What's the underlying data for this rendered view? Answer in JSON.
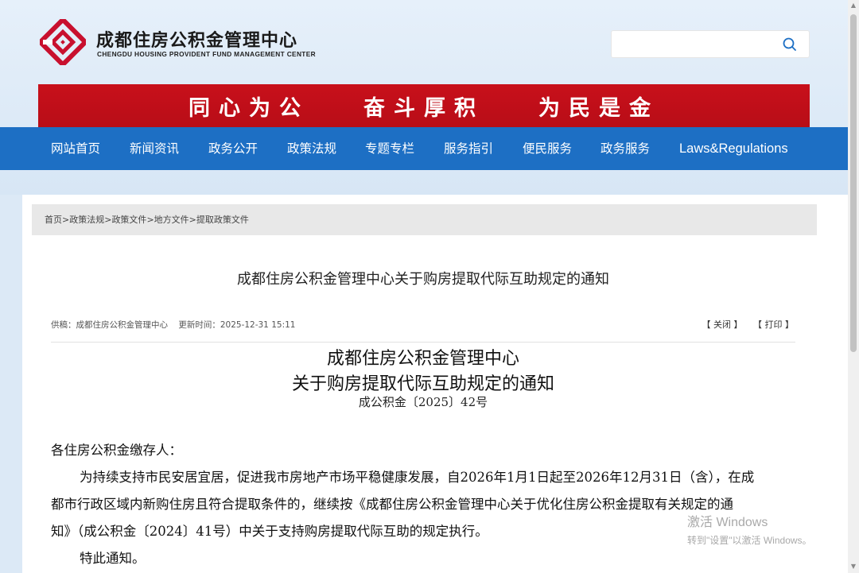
{
  "header": {
    "org_name_cn": "成都住房公积金管理中心",
    "org_name_en": "CHENGDU HOUSING PROVIDENT FUND MANAGEMENT CENTER",
    "logo_icon": "diamond-logo-icon",
    "search": {
      "placeholder": "",
      "value": "",
      "icon": "search-icon"
    }
  },
  "banner": {
    "slogans": [
      "同心为公",
      "奋斗厚积",
      "为民是金"
    ]
  },
  "nav": {
    "items": [
      "网站首页",
      "新闻资讯",
      "政务公开",
      "政策法规",
      "专题专栏",
      "服务指引",
      "便民服务",
      "政务服务",
      "Laws&Regulations"
    ]
  },
  "breadcrumb": [
    "首页",
    "政策法规",
    "政策文件",
    "地方文件",
    "提取政策文件"
  ],
  "article": {
    "title": "成都住房公积金管理中心关于购房提取代际互助规定的通知",
    "source": "供稿：成都住房公积金管理中心",
    "updated": "更新时间：2025-12-31 15:11",
    "close_label": "【 关闭 】",
    "print_label": "【 打印 】",
    "doc_title_line1": "成都住房公积金管理中心",
    "doc_title_line2": "关于购房提取代际互助规定的通知",
    "doc_number": "成公积金〔2025〕42号",
    "salutation": "各住房公积金缴存人：",
    "paragraph1_line1": "为持续支持市民安居宜居，促进我市房地产市场平稳健康发展，自2026年1月1日起至2026年12月31日（含），在成",
    "paragraph1_line2": "都市行政区域内新购住房且符合提取条件的，继续按《成都住房公积金管理中心关于优化住房公积金提取有关规定的通",
    "paragraph1_line3": "知》（成公积金〔2024〕41号）中关于支持购房提取代际互助的规定执行。",
    "closing": "特此通知。"
  },
  "watermark": {
    "line1": "激活 Windows",
    "line2": "转到\"设置\"以激活 Windows。"
  },
  "colors": {
    "banner_red": "#c8101b",
    "nav_blue": "#1d6fc4",
    "logo_red": "#c8102e"
  }
}
